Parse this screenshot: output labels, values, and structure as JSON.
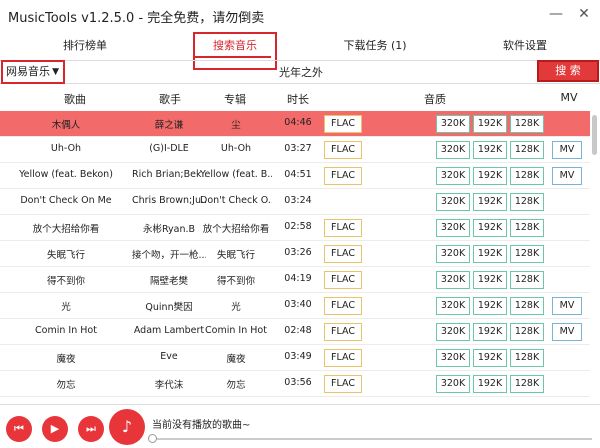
{
  "window": {
    "title": "MusicTools  v1.2.5.0 - 完全免费，请勿倒卖"
  },
  "tabs": [
    "排行榜单",
    "搜索音乐",
    "下载任务 (1)",
    "软件设置"
  ],
  "search": {
    "source": "网易音乐",
    "query": "光年之外",
    "button": "搜 索"
  },
  "columns": {
    "song": "歌曲",
    "artist": "歌手",
    "album": "专辑",
    "duration": "时长",
    "quality": "音质",
    "mv": "MV"
  },
  "rows": [
    {
      "song": "木偶人",
      "artist": "薛之谦",
      "album": "尘",
      "duration": "04:46",
      "flac": "FLAC",
      "q1": "320K",
      "q2": "192K",
      "q3": "128K",
      "mv": ""
    },
    {
      "song": "Uh-Oh",
      "artist": "(G)I-DLE",
      "album": "Uh-Oh",
      "duration": "03:27",
      "flac": "FLAC",
      "q1": "320K",
      "q2": "192K",
      "q3": "128K",
      "mv": "MV"
    },
    {
      "song": "Yellow (feat. Bekon)",
      "artist": "Rich Brian;Bek...",
      "album": "Yellow (feat. B...",
      "duration": "04:51",
      "flac": "FLAC",
      "q1": "320K",
      "q2": "192K",
      "q3": "128K",
      "mv": "MV"
    },
    {
      "song": "Don't Check On Me",
      "artist": "Chris Brown;Ju...",
      "album": "Don't Check O...",
      "duration": "03:24",
      "flac": "",
      "q1": "320K",
      "q2": "192K",
      "q3": "128K",
      "mv": ""
    },
    {
      "song": "放个大招给你看",
      "artist": "永彬Ryan.B",
      "album": "放个大招给你看",
      "duration": "02:58",
      "flac": "FLAC",
      "q1": "320K",
      "q2": "192K",
      "q3": "128K",
      "mv": ""
    },
    {
      "song": "失眠飞行",
      "artist": "接个吻，开一枪...",
      "album": "失眠飞行",
      "duration": "03:26",
      "flac": "FLAC",
      "q1": "320K",
      "q2": "192K",
      "q3": "128K",
      "mv": ""
    },
    {
      "song": "得不到你",
      "artist": "隔壁老樊",
      "album": "得不到你",
      "duration": "04:19",
      "flac": "FLAC",
      "q1": "320K",
      "q2": "192K",
      "q3": "128K",
      "mv": ""
    },
    {
      "song": "光",
      "artist": "Quinn樊因",
      "album": "光",
      "duration": "03:40",
      "flac": "FLAC",
      "q1": "320K",
      "q2": "192K",
      "q3": "128K",
      "mv": "MV"
    },
    {
      "song": "Comin In Hot",
      "artist": "Adam Lambert",
      "album": "Comin In Hot",
      "duration": "02:48",
      "flac": "FLAC",
      "q1": "320K",
      "q2": "192K",
      "q3": "128K",
      "mv": "MV"
    },
    {
      "song": "魔夜",
      "artist": "Eve",
      "album": "魔夜",
      "duration": "03:49",
      "flac": "FLAC",
      "q1": "320K",
      "q2": "192K",
      "q3": "128K",
      "mv": ""
    },
    {
      "song": "勿忘",
      "artist": "李代沫",
      "album": "勿忘",
      "duration": "03:56",
      "flac": "FLAC",
      "q1": "320K",
      "q2": "192K",
      "q3": "128K",
      "mv": ""
    }
  ],
  "player": {
    "now_playing": "当前没有播放的歌曲~"
  },
  "icons": {
    "minimize": "minimize-icon",
    "close": "close-icon",
    "prev": "prev-icon",
    "play": "play-icon",
    "next": "next-icon",
    "logo": "music-note-icon"
  },
  "colors": {
    "accent": "#d8262f",
    "highlight_row": "#f26a6a"
  }
}
